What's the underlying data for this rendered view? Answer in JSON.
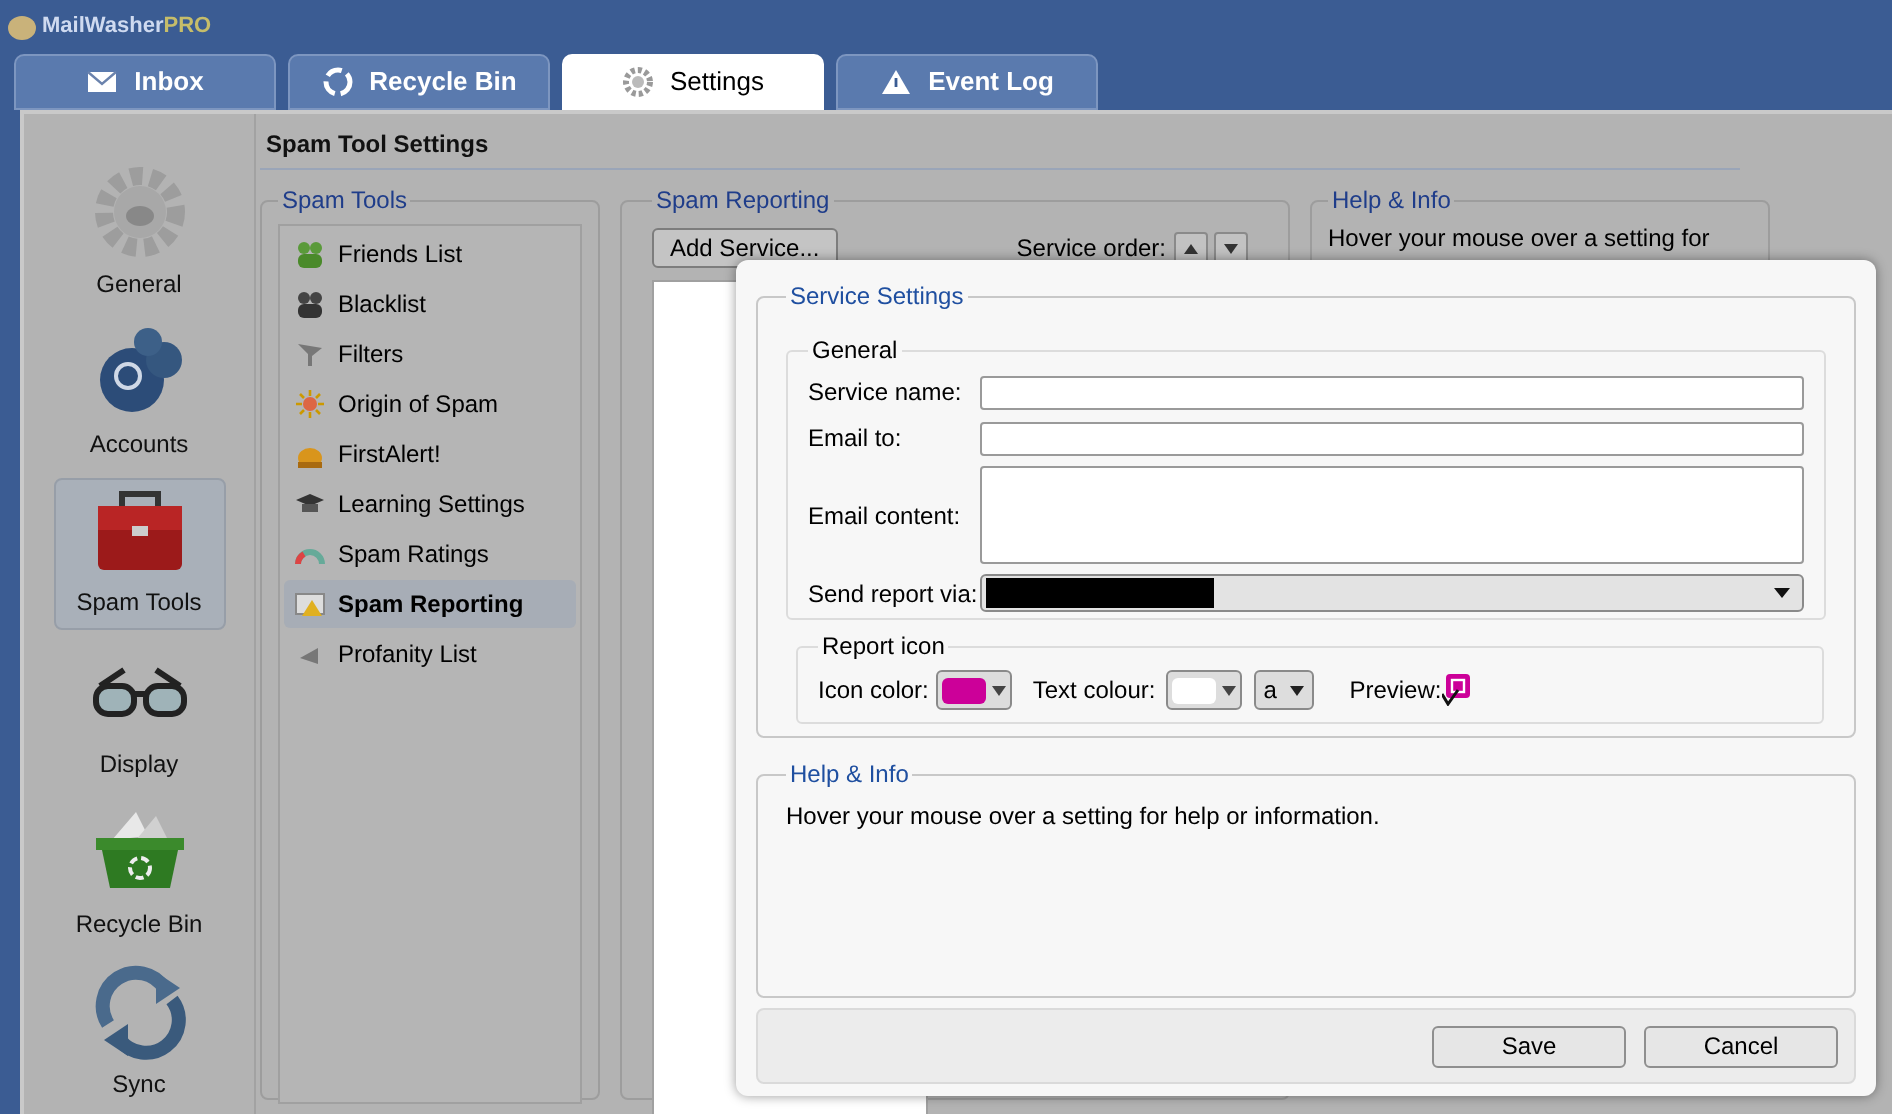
{
  "app": {
    "name": "MailWasher",
    "suffix": "PRO"
  },
  "tabs": [
    {
      "label": "Inbox",
      "selected": false
    },
    {
      "label": "Recycle Bin",
      "selected": false
    },
    {
      "label": "Settings",
      "selected": true
    },
    {
      "label": "Event Log",
      "selected": false
    }
  ],
  "nav": [
    {
      "label": "General",
      "selected": false
    },
    {
      "label": "Accounts",
      "selected": false
    },
    {
      "label": "Spam Tools",
      "selected": true
    },
    {
      "label": "Display",
      "selected": false
    },
    {
      "label": "Recycle Bin",
      "selected": false
    },
    {
      "label": "Sync",
      "selected": false
    }
  ],
  "section_title": "Spam Tool Settings",
  "spam_tools": {
    "title": "Spam Tools",
    "items": [
      {
        "label": "Friends List",
        "selected": false
      },
      {
        "label": "Blacklist",
        "selected": false
      },
      {
        "label": "Filters",
        "selected": false
      },
      {
        "label": "Origin of Spam",
        "selected": false
      },
      {
        "label": "FirstAlert!",
        "selected": false
      },
      {
        "label": "Learning Settings",
        "selected": false
      },
      {
        "label": "Spam Ratings",
        "selected": false
      },
      {
        "label": "Spam Reporting",
        "selected": true
      },
      {
        "label": "Profanity List",
        "selected": false
      }
    ]
  },
  "spam_reporting": {
    "title": "Spam Reporting",
    "add_button": "Add Service...",
    "order_label": "Service order:"
  },
  "help_behind": {
    "title": "Help & Info",
    "text": "Hover your mouse over a setting for"
  },
  "dialog": {
    "title": "Service Settings",
    "general": {
      "title": "General",
      "fields": [
        {
          "label": "Service name:",
          "kind": "text"
        },
        {
          "label": "Email to:",
          "kind": "text"
        },
        {
          "label": "Email content:",
          "kind": "textarea"
        },
        {
          "label": "Send report via:",
          "kind": "select"
        }
      ]
    },
    "report_icon": {
      "title": "Report icon",
      "icon_color_label": "Icon color:",
      "text_colour_label": "Text colour:",
      "letter": "a",
      "preview_label": "Preview:"
    },
    "help": {
      "title": "Help & Info",
      "text": "Hover your mouse over a setting for help or information."
    },
    "buttons": [
      "Save",
      "Cancel"
    ]
  }
}
